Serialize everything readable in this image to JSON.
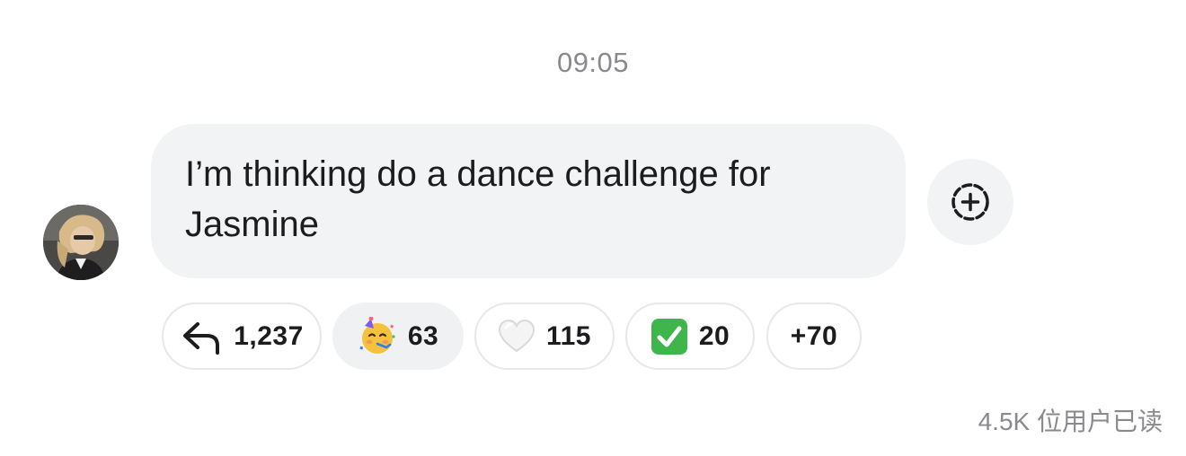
{
  "message": {
    "timestamp": "09:05",
    "text": "I’m thinking do a dance challenge for Jasmine"
  },
  "reactions": [
    {
      "icon": "reply-arrow-icon",
      "count": "1,237"
    },
    {
      "icon": "partying-face-emoji",
      "count": "63",
      "selected": true
    },
    {
      "icon": "white-heart-emoji",
      "count": "115"
    },
    {
      "icon": "check-mark-button-emoji",
      "count": "20"
    },
    {
      "icon": "",
      "count": "+70"
    }
  ],
  "read_receipt": "4.5K 位用户已读",
  "colors": {
    "bubble_bg": "#f2f3f5",
    "muted_text": "#8a8a8e",
    "check_green": "#3fb64b"
  }
}
